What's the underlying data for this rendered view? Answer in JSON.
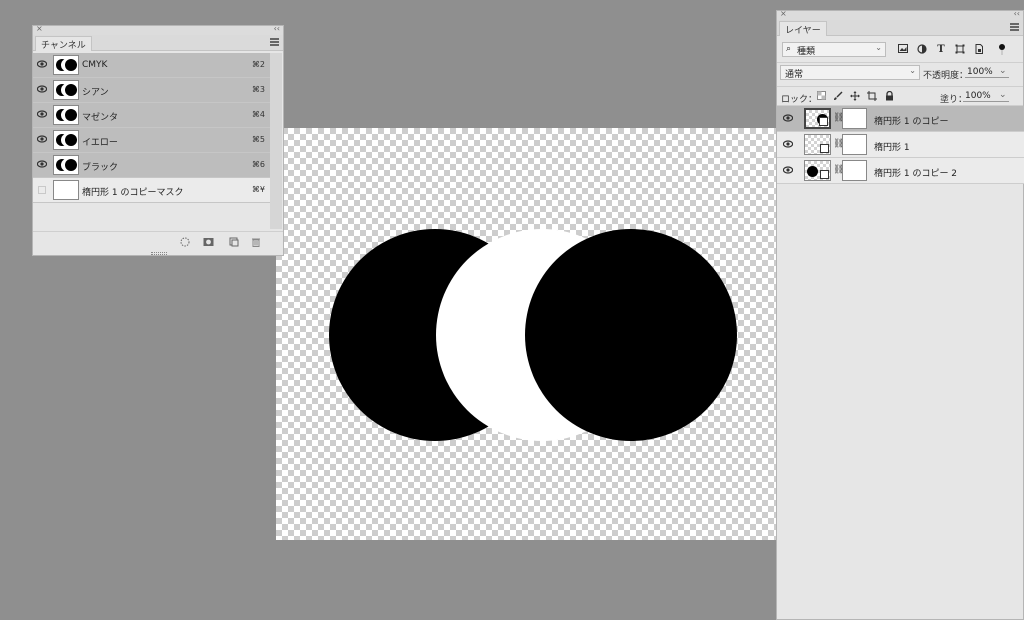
{
  "channels_panel": {
    "tab_label": "チャンネル",
    "channels": [
      {
        "name": "CMYK",
        "shortcut": "⌘2"
      },
      {
        "name": "シアン",
        "shortcut": "⌘3"
      },
      {
        "name": "マゼンタ",
        "shortcut": "⌘4"
      },
      {
        "name": "イエロー",
        "shortcut": "⌘5"
      },
      {
        "name": "ブラック",
        "shortcut": "⌘6"
      },
      {
        "name": "楕円形 1 のコピーマスク",
        "shortcut": "⌘¥"
      }
    ],
    "footer_icons": [
      "selection-load-icon",
      "save-mask-icon",
      "new-channel-icon",
      "trash-icon"
    ]
  },
  "layers_panel": {
    "tab_label": "レイヤー",
    "filter_kind": "種類",
    "blend_mode": "通常",
    "opacity_label": "不透明度：",
    "opacity_value": "100%",
    "lock_label": "ロック：",
    "fill_label": "塗り：",
    "fill_value": "100%",
    "layers": [
      {
        "name": "楕円形 1 のコピー",
        "selected": true
      },
      {
        "name": "楕円形 1",
        "selected": false
      },
      {
        "name": "楕円形 1 のコピー 2",
        "selected": false
      }
    ]
  },
  "colors": {
    "workspace": "#8f8f8f",
    "panel": "#e6e6e6",
    "selected_row": "#b9b9b9"
  }
}
